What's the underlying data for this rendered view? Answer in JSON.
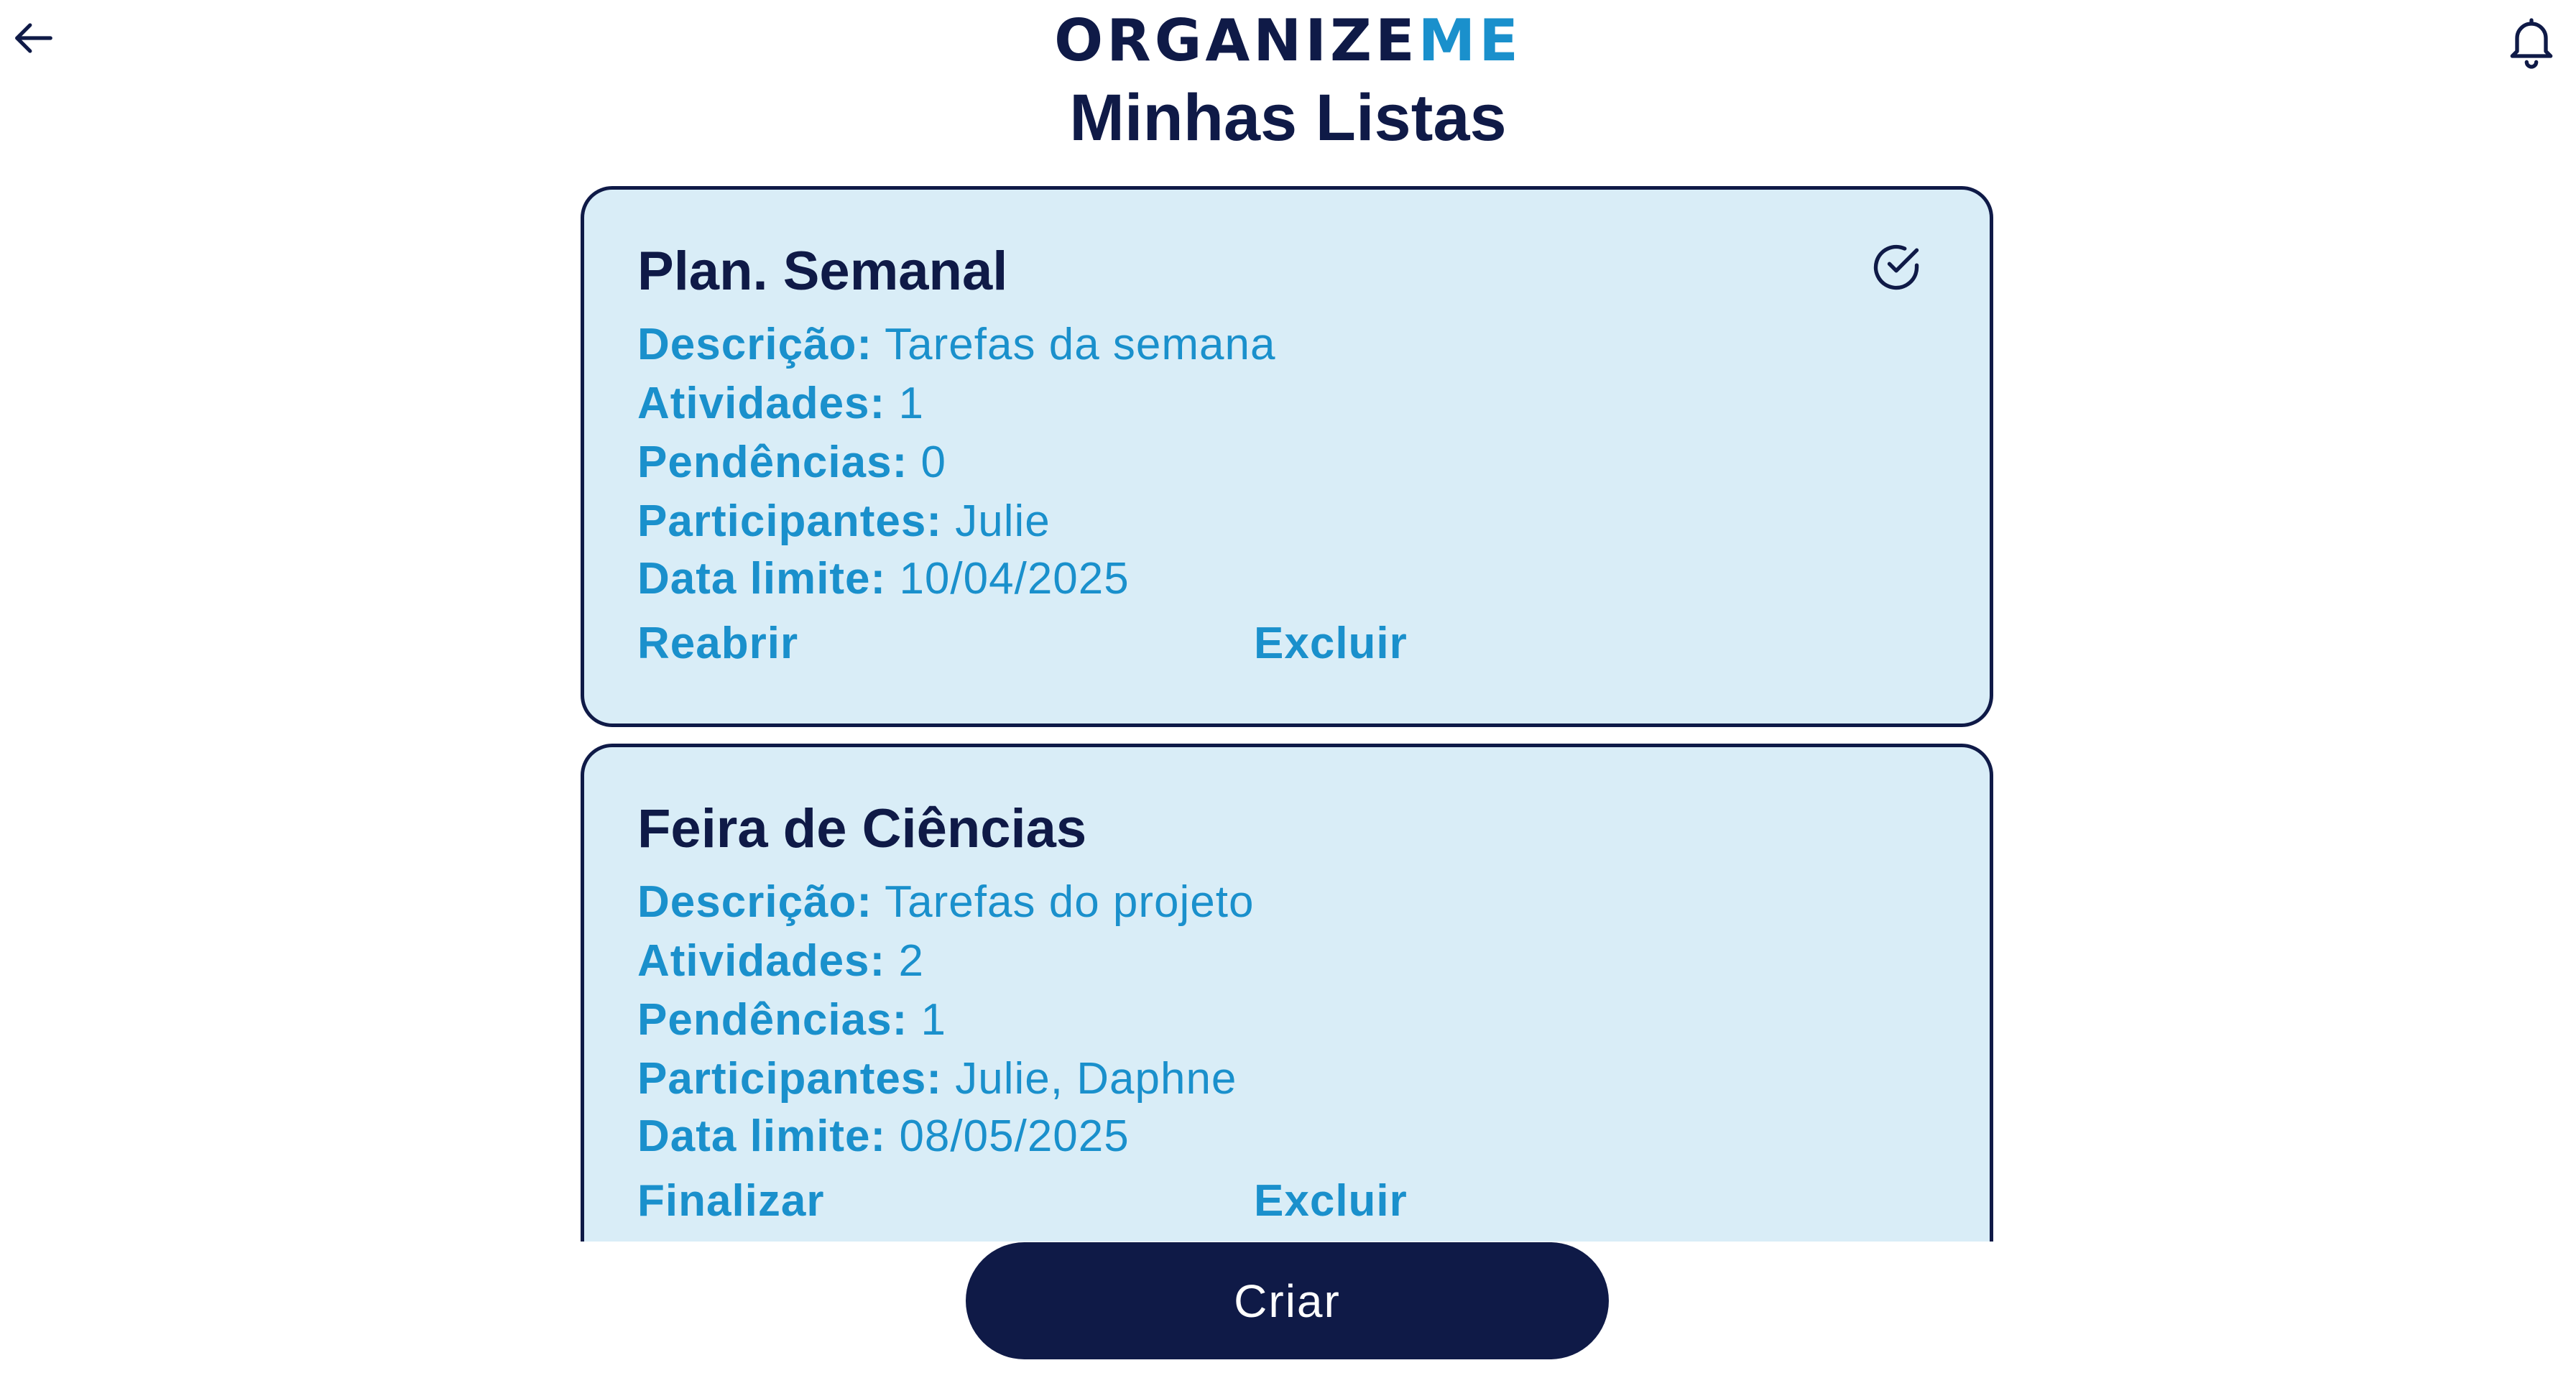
{
  "header": {
    "brand_part1": "ORGANIZE",
    "brand_part2": "ME",
    "title": "Minhas Listas",
    "back_icon": "arrow-left-icon",
    "notification_icon": "bell-icon"
  },
  "lists": [
    {
      "title": "Plan. Semanal",
      "status_icon": "check-circle-icon",
      "description_label": "Descrição:",
      "description": "Tarefas da semana",
      "activities_label": "Atividades:",
      "activities": "1",
      "pending_label": "Pendências:",
      "pending": "0",
      "participants_label": "Participantes:",
      "participants": "Julie",
      "deadline_label": "Data limite:",
      "deadline": "10/04/2025",
      "primary_action": "Reabrir",
      "delete_action": "Excluir"
    },
    {
      "title": "Feira de Ciências",
      "description_label": "Descrição:",
      "description": "Tarefas do projeto",
      "activities_label": "Atividades:",
      "activities": "2",
      "pending_label": "Pendências:",
      "pending": "1",
      "participants_label": "Participantes:",
      "participants": "Julie, Daphne",
      "deadline_label": "Data limite:",
      "deadline": "08/05/2025",
      "primary_action": "Finalizar",
      "delete_action": "Excluir"
    }
  ],
  "footer": {
    "create_label": "Criar"
  },
  "colors": {
    "navy": "#0f1a47",
    "accent_blue": "#1a90cc",
    "card_bg": "#d9edf7"
  }
}
